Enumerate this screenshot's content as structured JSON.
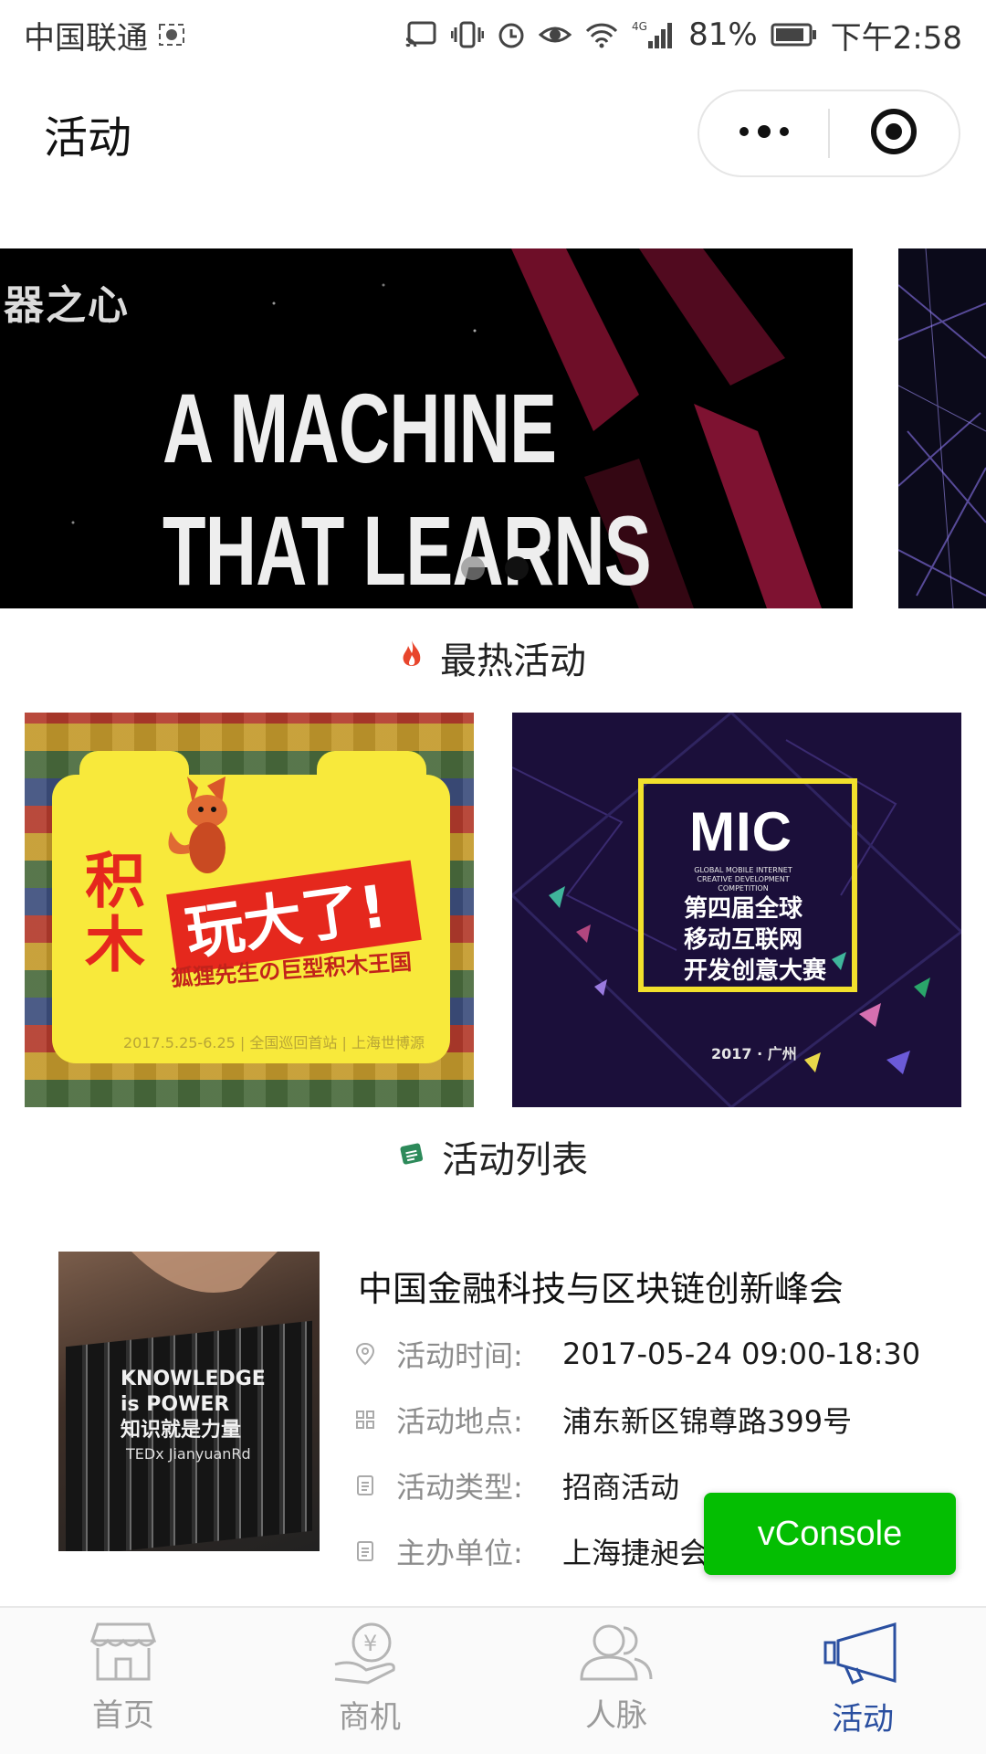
{
  "status_bar": {
    "carrier": "中国联通",
    "battery": "81%",
    "network": "4G",
    "time": "下午2:58"
  },
  "header": {
    "title": "活动",
    "menu_icon": "more-dots-icon",
    "close_icon": "target-circle-icon"
  },
  "banner": {
    "logo_text": "器之心",
    "headline_line1": "A MACHINE",
    "headline_line2": "THAT LEARNS ?",
    "active_index": 1,
    "slide_count": 2
  },
  "hot_section": {
    "title": "最热活动",
    "icon": "fire-icon",
    "cards": [
      {
        "chars_big": "积\n木",
        "title": "玩大了!",
        "subtitle": "狐狸先生の巨型积木王国",
        "date": "2017.5.25-6.25 | 全国巡回首站 | 上海世博源"
      },
      {
        "logo": "MIC",
        "en": "GLOBAL MOBILE INTERNET CREATIVE DEVELOPMENT COMPETITION",
        "cn": "第四届全球\n移动互联网\n开发创意大赛",
        "year": "2017 · 广州"
      }
    ]
  },
  "list_section": {
    "title": "活动列表",
    "icon": "list-icon",
    "items": [
      {
        "thumb_line1": "KNOWLEDGE",
        "thumb_line2": "is POWER",
        "thumb_line3": "知识就是力量",
        "thumb_ted": "TEDx JianyuanRd",
        "title": "中国金融科技与区块链创新峰会",
        "rows": [
          {
            "icon": "location-pin-icon",
            "label": "活动时间:",
            "value": "2017-05-24 09:00-18:30"
          },
          {
            "icon": "grid-icon",
            "label": "活动地点:",
            "value": "浦东新区锦尊路399号"
          },
          {
            "icon": "document-icon",
            "label": "活动类型:",
            "value": "招商活动"
          },
          {
            "icon": "document-icon",
            "label": "主办单位:",
            "value": "上海捷昶会"
          }
        ]
      }
    ]
  },
  "vconsole": {
    "label": "vConsole"
  },
  "tabbar": {
    "tabs": [
      {
        "label": "首页",
        "icon": "store-icon",
        "active": false
      },
      {
        "label": "商机",
        "icon": "money-hand-icon",
        "active": false
      },
      {
        "label": "人脉",
        "icon": "people-icon",
        "active": false
      },
      {
        "label": "活动",
        "icon": "megaphone-icon",
        "active": true
      }
    ],
    "active_color": "#2a4fa0",
    "inactive_color": "#9a9a9a"
  },
  "colors": {
    "accent_green": "#04be02",
    "fire": "#e8452c",
    "list_icon": "#2d8a5a"
  }
}
